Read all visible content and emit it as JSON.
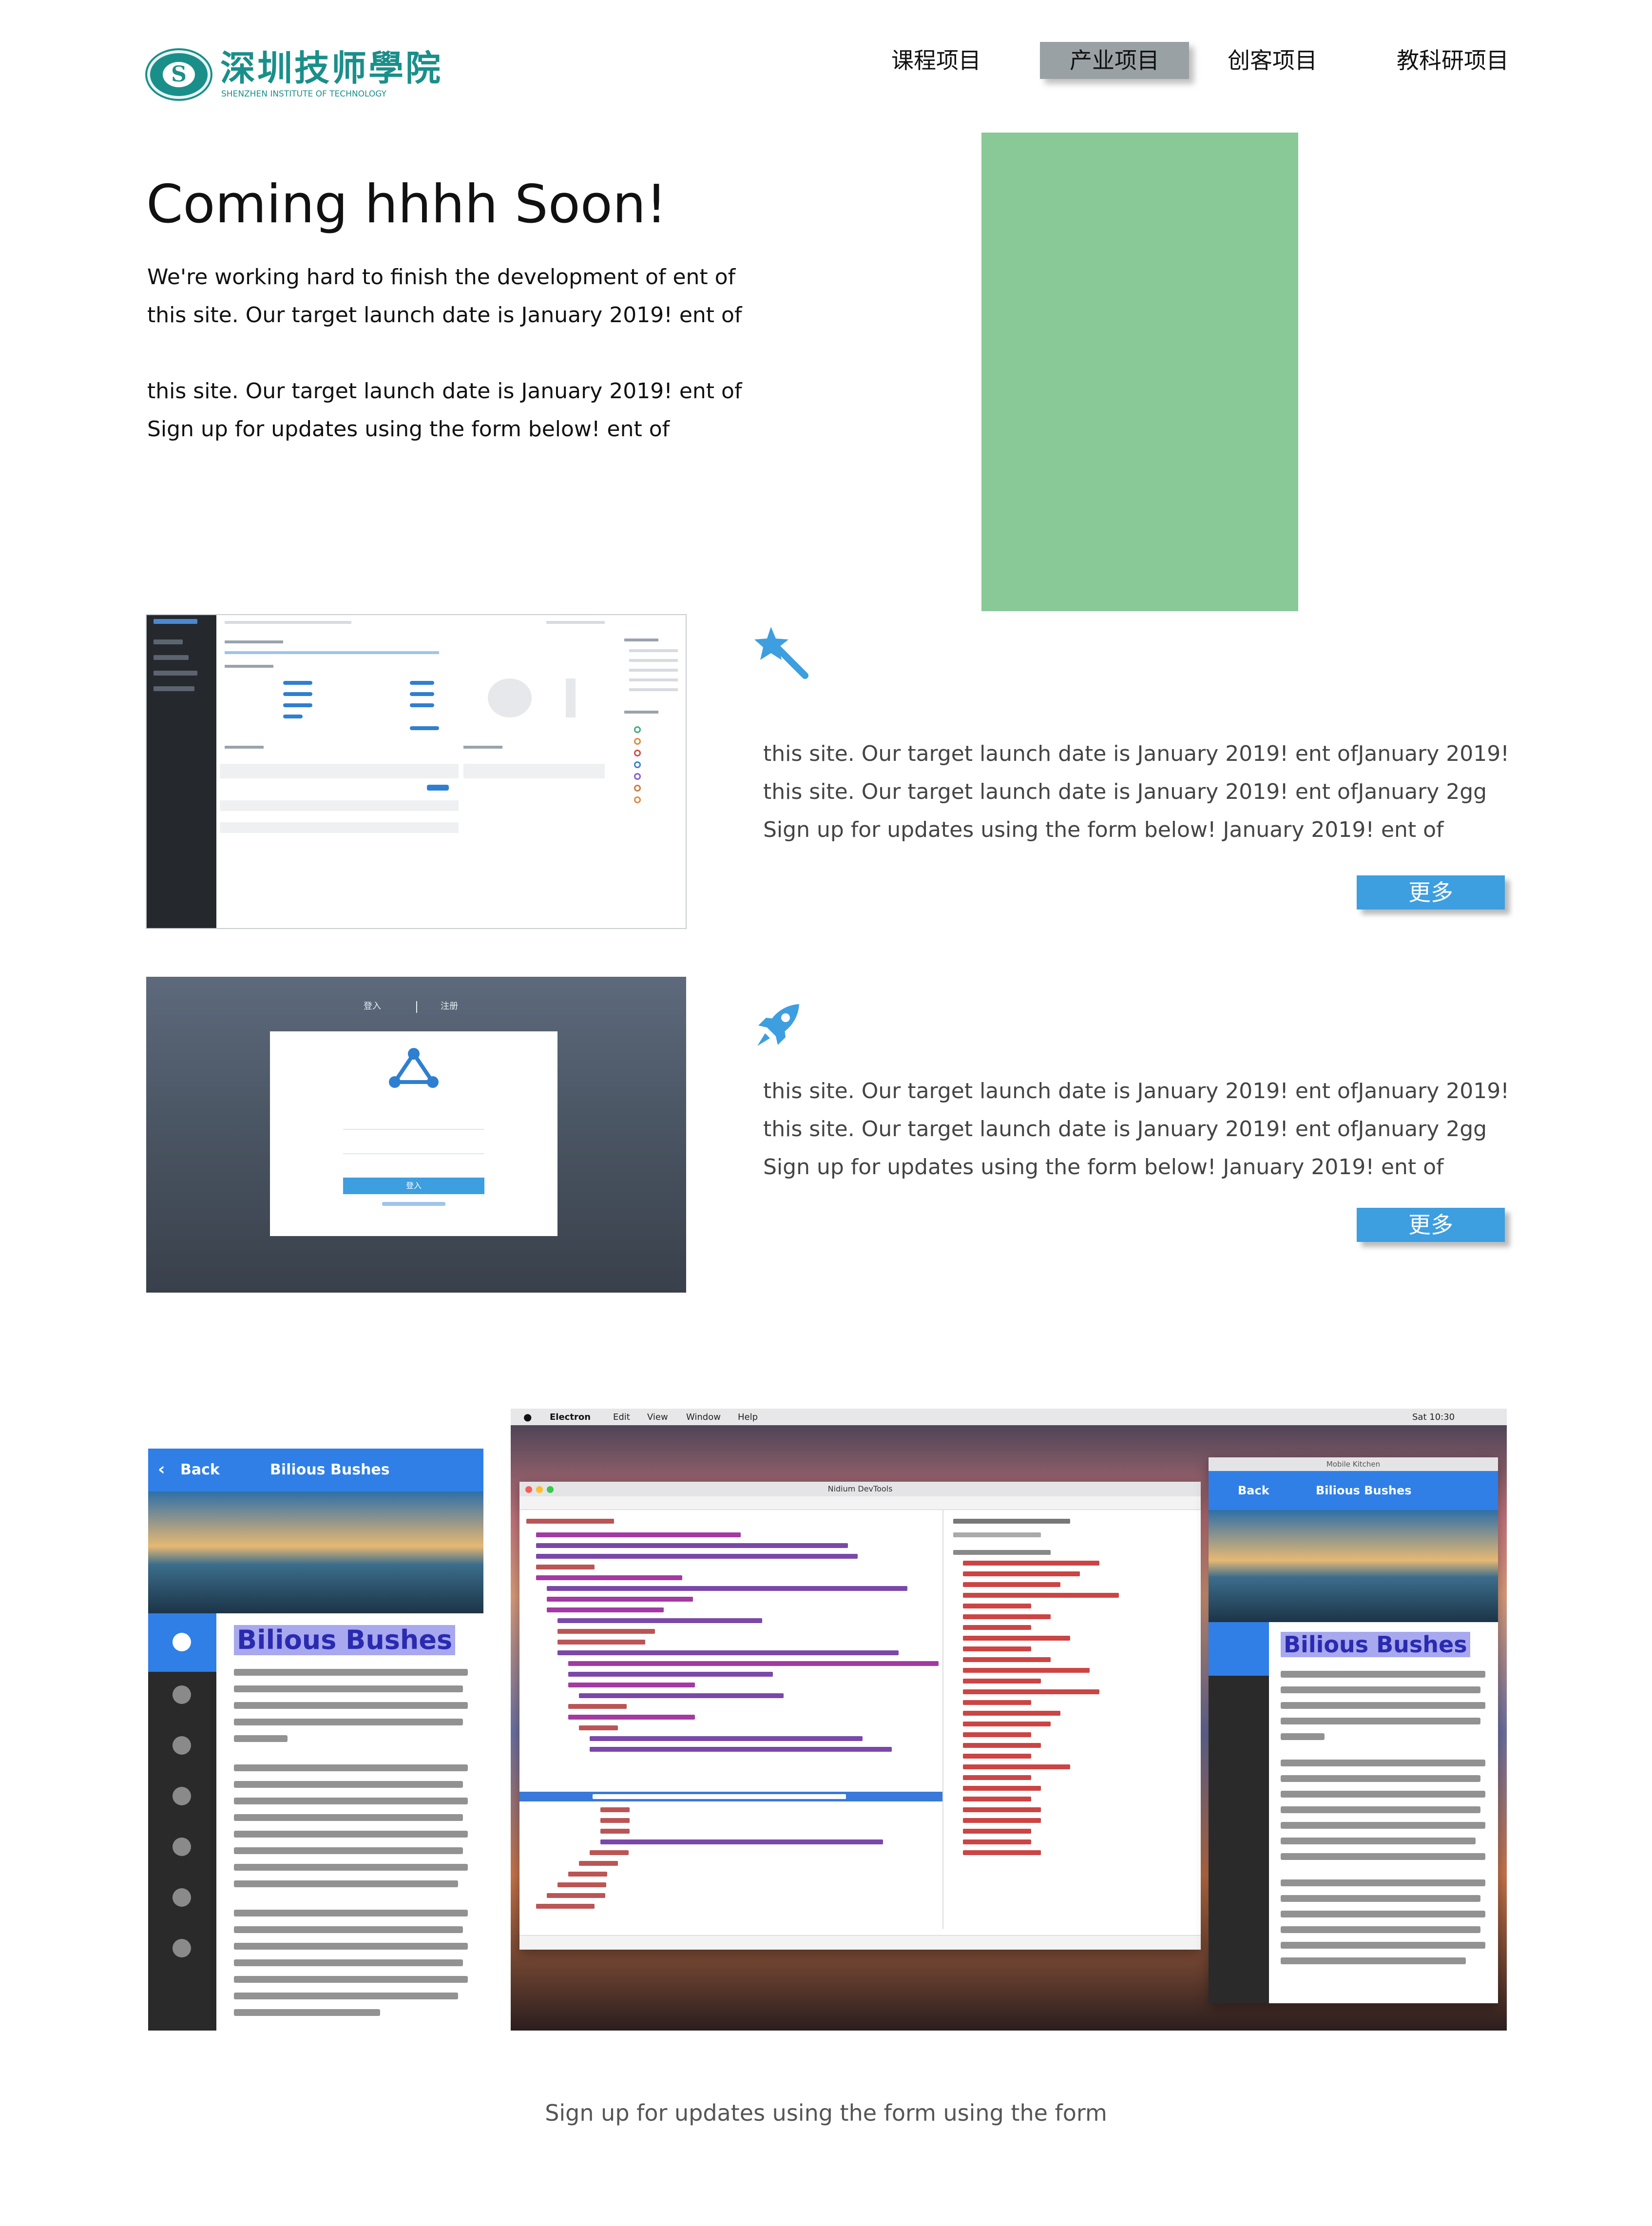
{
  "header": {
    "logo_cn": "深圳技师學院",
    "logo_en": "SHENZHEN INSTITUTE OF TECHNOLOGY",
    "logo_mark": "S",
    "nav": [
      {
        "label": "课程项目",
        "active": false
      },
      {
        "label": "产业项目",
        "active": true
      },
      {
        "label": "创客项目",
        "active": false
      },
      {
        "label": "教科研项目",
        "active": false
      }
    ]
  },
  "hero": {
    "title": "Coming hhhh Soon!",
    "lines": [
      "We're working hard to finish the development of ent of",
      "this site. Our target launch date is January 2019! ent of",
      "this site. Our target launch date is January 2019! ent of",
      "Sign up for updates using the form below! ent of"
    ]
  },
  "features": [
    {
      "icon": "magic-wand-icon",
      "lines": [
        "this site. Our target launch date is January 2019! ent ofJanuary 2019!",
        "this site. Our target launch date is January 2019! ent ofJanuary 2gg",
        "Sign up for updates using the form below! January 2019! ent of"
      ],
      "button": "更多"
    },
    {
      "icon": "rocket-icon",
      "lines": [
        "this site. Our target launch date is January 2019! ent ofJanuary 2019!",
        "this site. Our target launch date is January 2019! ent ofJanuary 2gg",
        "Sign up for updates using the form below! January 2019! ent of"
      ],
      "button": "更多"
    }
  ],
  "login_mock": {
    "tab_login": "登入",
    "tab_register": "注册",
    "button": "登入"
  },
  "showcase": {
    "phone_back": "Back",
    "phone_header": "Bilious Bushes",
    "phone_title": "Bilious Bushes",
    "devtools_title": "Nidium DevTools",
    "menubar": [
      "Electron",
      "Edit",
      "View",
      "Window",
      "Help"
    ],
    "menubar_clock": "Sat 10:30",
    "mini_window_title": "Mobile Kitchen"
  },
  "footer": {
    "text": "Sign up for updates using the form using the form"
  },
  "colors": {
    "brand": "#1a8f8a",
    "accent": "#3d9ee0",
    "hero_block": "#89c897",
    "nav_active": "#9aa1a4"
  }
}
